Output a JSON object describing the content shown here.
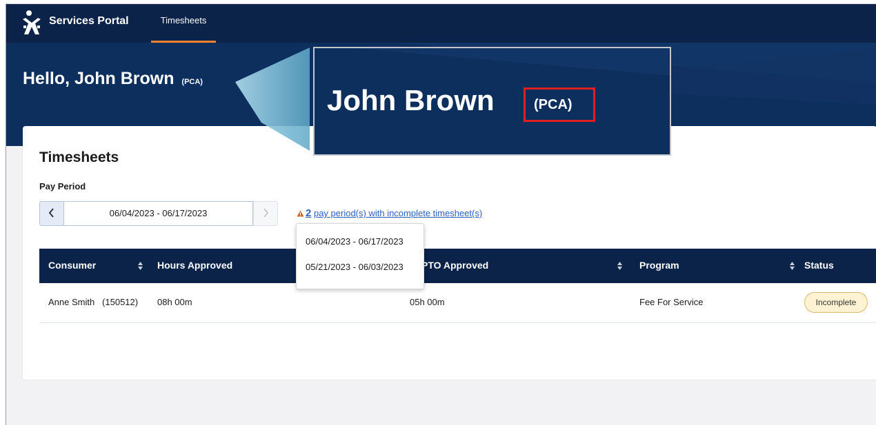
{
  "header": {
    "brand": "Services Portal",
    "tabs": [
      {
        "label": "Timesheets",
        "active": true
      }
    ],
    "accent_color": "#f3822a",
    "bar_color": "#0b2348"
  },
  "hero": {
    "greeting": "Hello,",
    "user_name": "John Brown",
    "role": "(PCA)"
  },
  "zoom_callout": {
    "name": "John Brown",
    "role": "(PCA)",
    "highlight_color": "#e02020"
  },
  "timesheets": {
    "title": "Timesheets",
    "pay_period_label": "Pay Period",
    "pay_period_value": "06/04/2023 - 06/17/2023",
    "prev_icon": "chevron-left-icon",
    "next_icon": "chevron-right-icon",
    "warning": {
      "icon": "warning-icon",
      "count": "2",
      "text": "pay period(s) with incomplete timesheet(s)",
      "color": "#c9621f"
    },
    "dropdown": [
      "06/04/2023 - 06/17/2023",
      "05/21/2023 - 06/03/2023"
    ],
    "columns": {
      "consumer": "Consumer",
      "hours_approved": "Hours Approved",
      "pto_approved": "PTO Approved",
      "program": "Program",
      "status": "Status"
    },
    "rows": [
      {
        "consumer": "Anne Smith",
        "consumer_id": "(150512)",
        "hours_approved": "08h 00m",
        "pto_approved": "05h 00m",
        "program": "Fee For Service",
        "status": "Incomplete"
      }
    ]
  }
}
